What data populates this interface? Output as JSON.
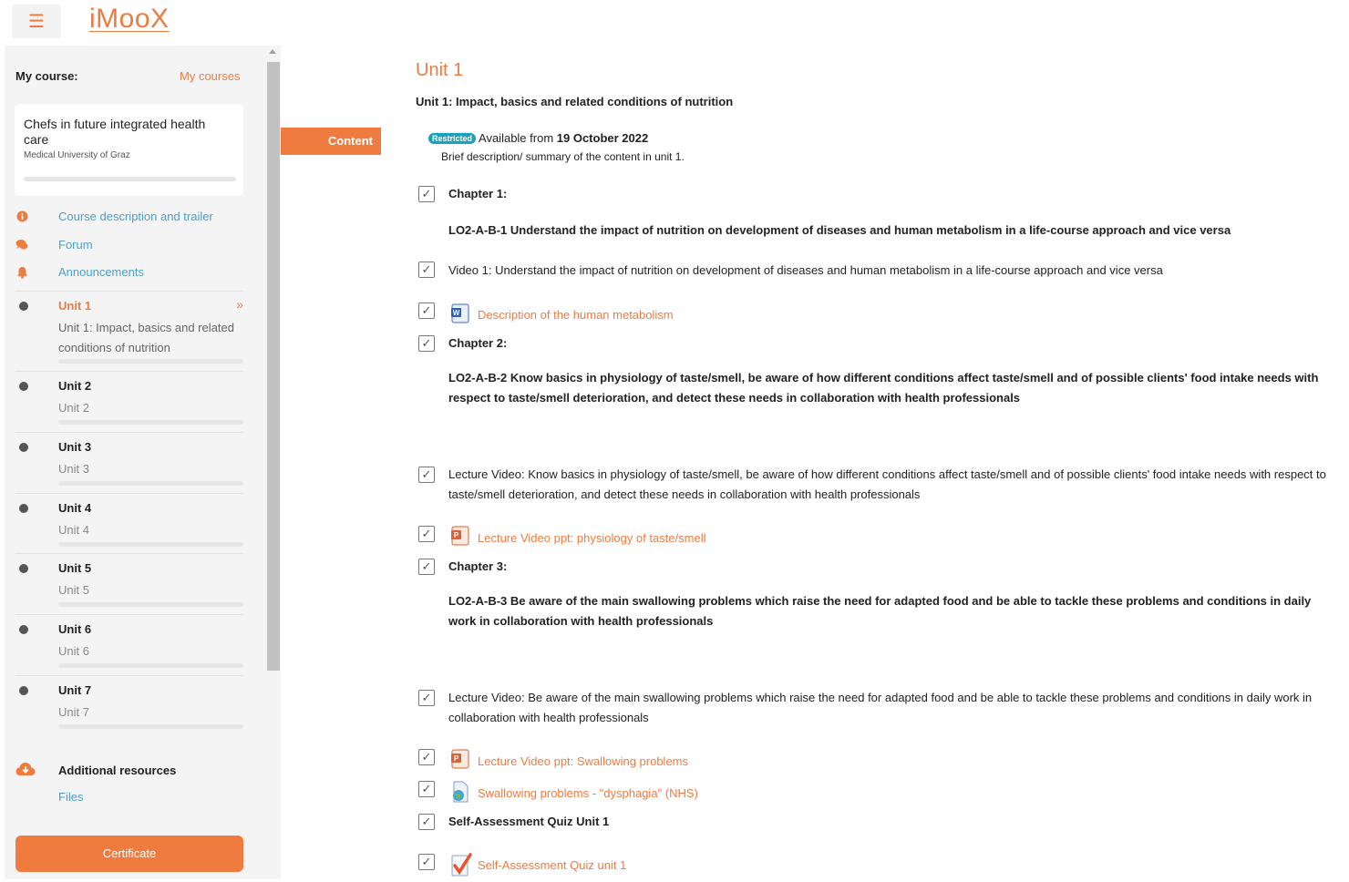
{
  "header": {
    "logo": "iMooX",
    "menu_icon": "hamburger-icon"
  },
  "sidebar": {
    "my_course_label": "My course:",
    "my_courses_link": "My courses",
    "course": {
      "title": "Chefs in future integrated health care",
      "organization": "Medical University of Graz"
    },
    "links": [
      {
        "label": "Course description and trailer",
        "icon": "info-icon"
      },
      {
        "label": "Forum",
        "icon": "chat-icon"
      },
      {
        "label": "Announcements",
        "icon": "bell-icon"
      }
    ],
    "units": [
      {
        "title": "Unit 1",
        "subtitle": "Unit 1: Impact, basics and related conditions of nutrition",
        "active": true
      },
      {
        "title": "Unit 2",
        "subtitle": "Unit 2"
      },
      {
        "title": "Unit 3",
        "subtitle": "Unit 3"
      },
      {
        "title": "Unit 4",
        "subtitle": "Unit 4"
      },
      {
        "title": "Unit 5",
        "subtitle": "Unit 5"
      },
      {
        "title": "Unit 6",
        "subtitle": "Unit 6"
      },
      {
        "title": "Unit 7",
        "subtitle": "Unit 7"
      }
    ],
    "additional_resources": "Additional resources",
    "files_link": "Files",
    "certificate_button": "Certificate"
  },
  "content_tab": "Content",
  "main": {
    "heading": "Unit 1",
    "subheading": "Unit 1: Impact, basics and related conditions of nutrition",
    "restricted_badge": "Restricted",
    "available_prefix": "Available from ",
    "available_date": "19 October 2022",
    "brief": "Brief description/ summary of the content in unit 1.",
    "chapter1": "Chapter 1:",
    "lo1": "LO2-A-B-1 Understand the impact of nutrition on development of diseases and human metabolism in a life-course approach and vice versa",
    "video1": "Video 1: Understand the impact of nutrition on development of diseases and human metabolism in a life-course approach and vice versa",
    "doc1": "Description of the human metabolism",
    "chapter2": "Chapter 2:",
    "lo2": "LO2-A-B-2 Know basics in physiology of taste/smell, be aware of how different conditions affect taste/smell and of possible clients' food intake needs with respect to taste/smell deterioration, and detect these needs in collaboration with health professionals",
    "video2": "Lecture Video: Know basics in physiology of taste/smell, be aware of how different conditions affect taste/smell and of possible clients' food intake needs with respect to taste/smell deterioration, and detect these needs in collaboration with health professionals",
    "ppt1": "Lecture Video ppt: physiology of taste/smell",
    "chapter3": "Chapter 3:",
    "lo3": "LO2-A-B-3 Be aware of the main swallowing problems which raise the need for adapted food and be able to tackle these problems and conditions in daily work in collaboration with health professionals",
    "video3": "Lecture Video: Be aware of the main swallowing problems which raise the need for adapted food and be able to tackle these problems and conditions in daily work in collaboration with health professionals",
    "ppt2": "Lecture Video ppt: Swallowing problems",
    "url1": "Swallowing problems - \"dysphagia\" (NHS)",
    "quiz_label": "Self-Assessment Quiz Unit 1",
    "quiz_link": "Self-Assessment Quiz unit 1"
  }
}
